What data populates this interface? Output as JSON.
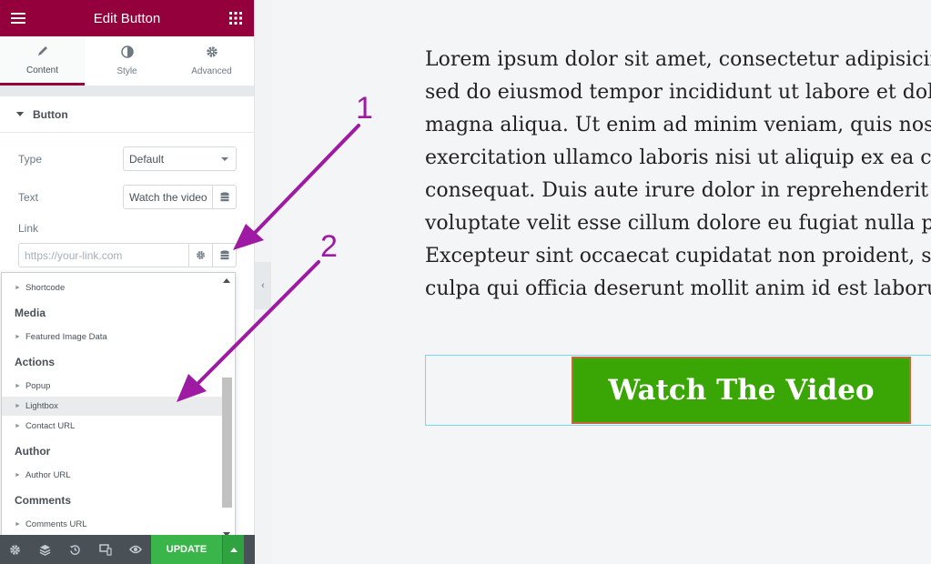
{
  "panel": {
    "title": "Edit Button",
    "tabs": [
      {
        "label": "Content",
        "icon": "pencil-icon",
        "active": true
      },
      {
        "label": "Style",
        "icon": "contrast-icon",
        "active": false
      },
      {
        "label": "Advanced",
        "icon": "gear-icon",
        "active": false
      }
    ],
    "section_title": "Button",
    "fields": {
      "type_label": "Type",
      "type_value": "Default",
      "text_label": "Text",
      "text_value": "Watch the video",
      "link_label": "Link",
      "link_placeholder": "https://your-link.com"
    },
    "dynamic_list": {
      "items": [
        {
          "kind": "item",
          "label": "Shortcode"
        },
        {
          "kind": "group",
          "label": "Media"
        },
        {
          "kind": "item",
          "label": "Featured Image Data"
        },
        {
          "kind": "group",
          "label": "Actions"
        },
        {
          "kind": "item",
          "label": "Popup"
        },
        {
          "kind": "item",
          "label": "Lightbox",
          "highlighted": true
        },
        {
          "kind": "item",
          "label": "Contact URL"
        },
        {
          "kind": "group",
          "label": "Author"
        },
        {
          "kind": "item",
          "label": "Author URL"
        },
        {
          "kind": "group",
          "label": "Comments"
        },
        {
          "kind": "item",
          "label": "Comments URL"
        }
      ]
    },
    "footer": {
      "icons": [
        "settings-icon",
        "layers-icon",
        "history-icon",
        "responsive-icon",
        "preview-eye-icon"
      ],
      "update_label": "UPDATE"
    }
  },
  "preview": {
    "paragraph_lines": [
      "Lorem ipsum dolor sit amet, consectetur adipisicing elit,",
      "sed do eiusmod tempor incididunt ut labore et dolore",
      "magna aliqua. Ut enim ad minim veniam, quis nostrud",
      "exercitation ullamco laboris nisi ut aliquip ex ea commodo",
      "consequat. Duis aute irure dolor in reprehenderit in",
      "voluptate velit esse cillum dolore eu fugiat nulla pariatur.",
      "Excepteur sint occaecat cupidatat non proident, sunt in",
      "culpa qui officia deserunt mollit anim id est laborum."
    ],
    "button_text": "Watch The Video"
  },
  "annotations": {
    "labels": [
      "1",
      "2"
    ],
    "color": "#9e1aa3"
  },
  "colors": {
    "brand": "#93003c",
    "update": "#39b54a",
    "cta": "#3aa605",
    "cta_border": "#c9653f"
  }
}
